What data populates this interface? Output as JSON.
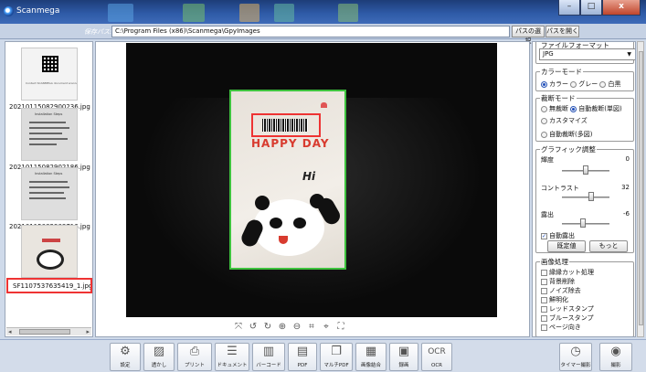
{
  "window": {
    "title": "Scanmega",
    "minimize": "–",
    "maximize": "□",
    "close": "x"
  },
  "path_bar": {
    "label": "保存パス:",
    "value": "C:\\Program Files (x86)\\Scanmega\\GpyImages",
    "select_button": "パスの選択",
    "open_button": "パスを開く"
  },
  "thumbnails": [
    {
      "caption": "20210115082900236.jpg",
      "tiny_text": "Contact SCANMEGA document scanner"
    },
    {
      "caption": "20210115082902186.jpg",
      "tiny_text": "Installation Steps"
    },
    {
      "caption": "20210115082903716.jpg",
      "tiny_text": "Installation Steps"
    },
    {
      "caption": "SF1107537635419_1.jpg",
      "tiny_text": ""
    }
  ],
  "preview": {
    "happy_text": "HAPPY DAY",
    "hi_text": "Hi"
  },
  "view_tools": [
    {
      "icon": "fit-icon",
      "glyph": "⤧"
    },
    {
      "icon": "rotate-left-icon",
      "glyph": "↺"
    },
    {
      "icon": "rotate-right-icon",
      "glyph": "↻"
    },
    {
      "icon": "zoom-in-icon",
      "glyph": "⊕"
    },
    {
      "icon": "zoom-out-icon",
      "glyph": "⊖"
    },
    {
      "icon": "crop-icon",
      "glyph": "⌗"
    },
    {
      "icon": "center-icon",
      "glyph": "⌖"
    },
    {
      "icon": "expand-icon",
      "glyph": "⛶"
    }
  ],
  "settings": {
    "file_format": {
      "label": "ファイルフォーマット",
      "value": "JPG"
    },
    "color_mode": {
      "label": "カラーモード",
      "options": [
        "カラー",
        "グレー",
        "白黒"
      ],
      "selected": 0
    },
    "crop_mode": {
      "label": "裁断モード",
      "options": [
        "無裁断",
        "自動裁断(単図)",
        "カスタマイズ",
        "自動裁断(多図)"
      ],
      "selected": 1
    },
    "graphic": {
      "label": "グラフィック調整",
      "brightness": {
        "label": "輝度",
        "value": "0",
        "level": 0.5
      },
      "contrast": {
        "label": "コントラスト",
        "value": "32",
        "level": 0.62
      },
      "exposure": {
        "label": "露出",
        "value": "-6",
        "level": 0.44
      },
      "auto_exposure": {
        "label": "自動露出",
        "checked": true
      },
      "default_button": "既定値",
      "more_button": "もっと"
    },
    "image_processing": {
      "label": "画像処理",
      "items": [
        "縁縁カット処理",
        "背景削除",
        "ノイズ除去",
        "鮮明化",
        "レッドスタンプ",
        "ブルースタンプ",
        "ページ向き"
      ]
    }
  },
  "toolbar": [
    {
      "name": "settings",
      "label": "設定",
      "icon": "gear-icon",
      "glyph": "⚙"
    },
    {
      "name": "watermark",
      "label": "透かし",
      "icon": "watermark-icon",
      "glyph": "▨"
    },
    {
      "name": "print",
      "label": "プリント",
      "icon": "printer-icon",
      "glyph": "⎙"
    },
    {
      "name": "document",
      "label": "ドキュメント",
      "icon": "document-icon",
      "glyph": "☰"
    },
    {
      "name": "barcode",
      "label": "バーコード",
      "icon": "barcode-icon",
      "glyph": "▥"
    },
    {
      "name": "pdf",
      "label": "PDF",
      "icon": "pdf-icon",
      "glyph": "▤"
    },
    {
      "name": "multi-pdf",
      "label": "マルチPDF",
      "icon": "multi-pdf-icon",
      "glyph": "❐"
    },
    {
      "name": "image-merge",
      "label": "画像結合",
      "icon": "merge-icon",
      "glyph": "▦"
    },
    {
      "name": "video",
      "label": "録画",
      "icon": "video-icon",
      "glyph": "▣"
    },
    {
      "name": "ocr",
      "label": "OCR",
      "icon": "ocr-icon",
      "glyph": "OCR"
    },
    {
      "name": "timer",
      "label": "タイマー撮影",
      "icon": "timer-icon",
      "glyph": "◷"
    },
    {
      "name": "capture",
      "label": "撮影",
      "icon": "camera-icon",
      "glyph": "◉"
    }
  ]
}
